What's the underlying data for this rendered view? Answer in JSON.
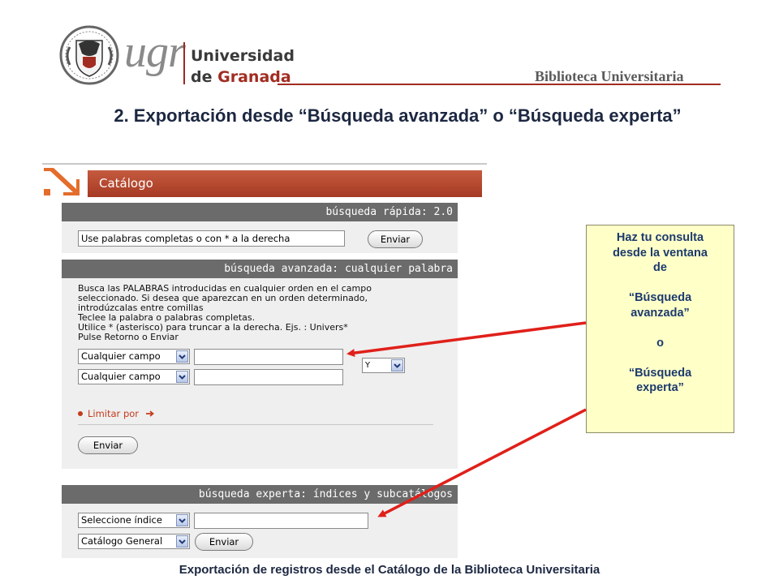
{
  "header": {
    "logo_text": "ugr",
    "university_line1": "Universidad",
    "university_line2_prefix": "de",
    "university_line2_rest": "Granada",
    "library_name": "Biblioteca Universitaria"
  },
  "slide_title": "2. Exportación desde “Búsqueda avanzada” o “Búsqueda experta”",
  "catalog": {
    "title": "Catálogo",
    "quick_search": {
      "header": "búsqueda rápida: 2.0",
      "input_value": "Use palabras completas o con * a la derecha",
      "send_label": "Enviar"
    },
    "advanced_search": {
      "header": "búsqueda avanzada: cualquier palabra",
      "description": [
        "Busca las PALABRAS introducidas en cualquier orden en el campo",
        "seleccionado. Si desea que aparezcan en un orden determinado,",
        "introdúzcalas entre comillas",
        "Teclee la palabra o palabras completas.",
        "Utilice * (asterisco) para truncar a la derecha. Ejs. : Univers*",
        "Pulse Retorno o Enviar"
      ],
      "field1_select": "Cualquier campo",
      "field1_value": "",
      "field2_select": "Cualquier campo",
      "field2_value": "",
      "operator_select": "Y",
      "limit_label": "Limitar por",
      "send_label": "Enviar"
    },
    "expert_search": {
      "header": "búsqueda experta: índices y subcatálogos",
      "index_select": "Seleccione índice",
      "index_value": "",
      "catalog_select": "Catálogo General",
      "send_label": "Enviar"
    }
  },
  "callout": {
    "lines": [
      "Haz tu consulta",
      "desde la ventana",
      "de",
      "",
      "“Búsqueda",
      "avanzada”",
      "",
      "o",
      "",
      "“Búsqueda",
      "experta”"
    ]
  },
  "footer": "Exportación de registros desde el Catálogo de la Biblioteca Universitaria",
  "colors": {
    "brand_red": "#a22c22",
    "catalog_bar": "#b44a30",
    "panel_header": "#6b6b6b",
    "callout_bg": "#ffffc8",
    "arrow": "#e0201a",
    "title_text": "#1c2741"
  }
}
